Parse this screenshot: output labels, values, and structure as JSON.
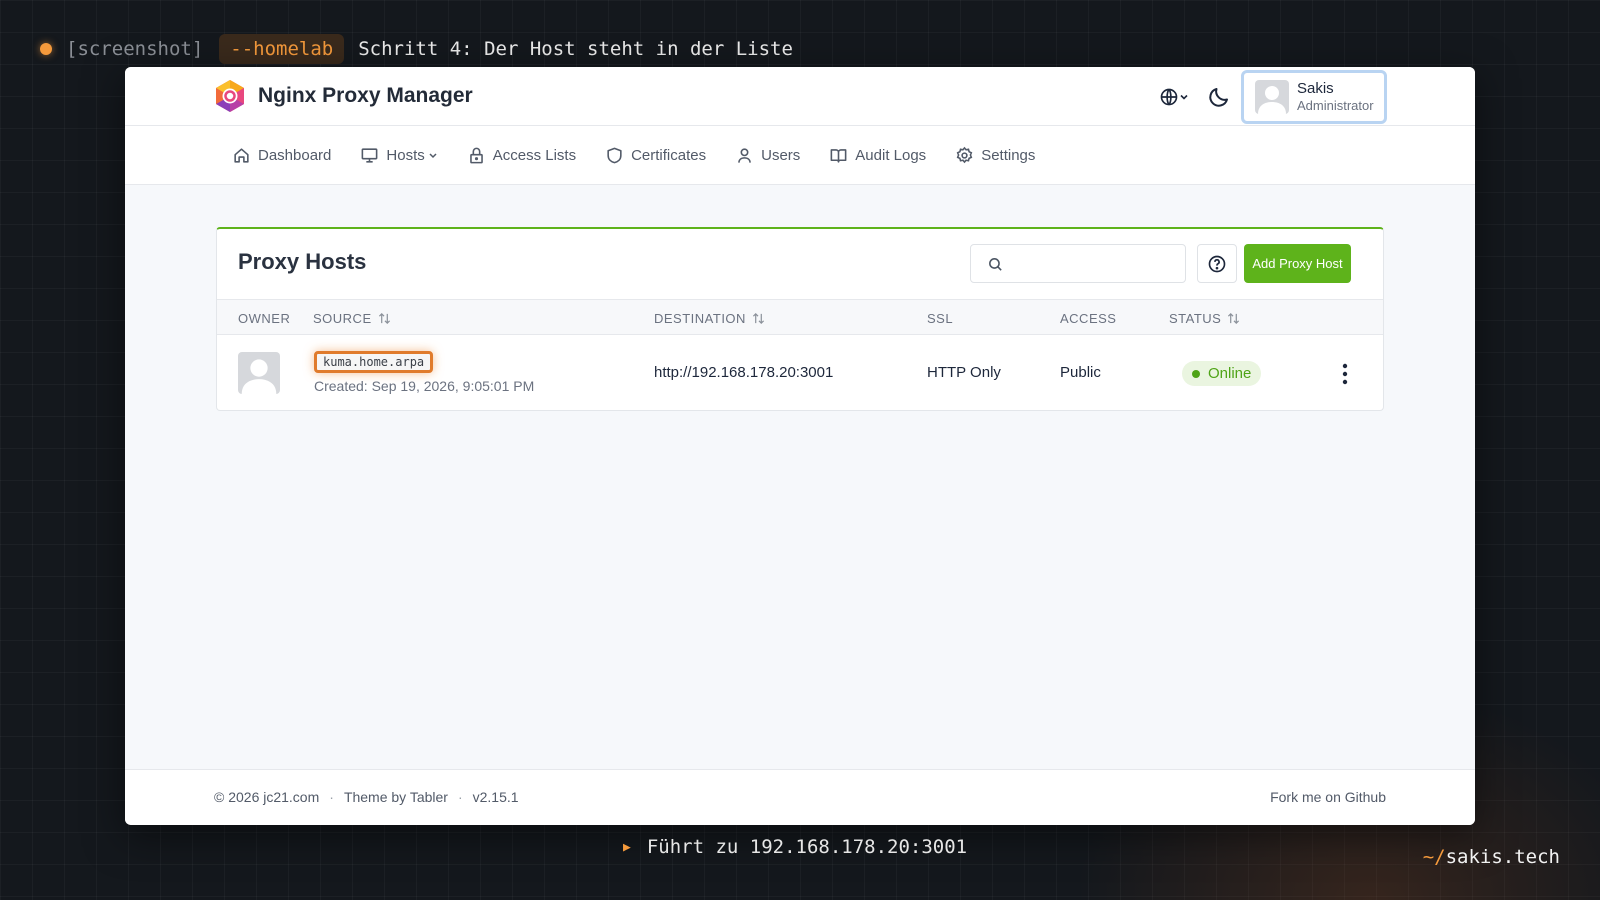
{
  "caption": {
    "tag": "[screenshot]",
    "pill": "--homelab",
    "title": "Schritt 4: Der Host steht in der Liste"
  },
  "app": {
    "name": "Nginx Proxy Manager",
    "user": {
      "name": "Sakis",
      "role": "Administrator"
    }
  },
  "nav": [
    {
      "label": "Dashboard",
      "icon": "home-icon"
    },
    {
      "label": "Hosts",
      "icon": "monitor-icon"
    },
    {
      "label": "Access Lists",
      "icon": "lock-icon"
    },
    {
      "label": "Certificates",
      "icon": "shield-icon"
    },
    {
      "label": "Users",
      "icon": "user-icon"
    },
    {
      "label": "Audit Logs",
      "icon": "book-icon"
    },
    {
      "label": "Settings",
      "icon": "gear-icon"
    }
  ],
  "card": {
    "title": "Proxy Hosts",
    "search_placeholder": "",
    "add_button": "Add Proxy Host",
    "columns": [
      "OWNER",
      "SOURCE",
      "DESTINATION",
      "SSL",
      "ACCESS",
      "STATUS"
    ],
    "rows": [
      {
        "source": "kuma.home.arpa",
        "created": "Created: Sep 19, 2026, 9:05:01 PM",
        "destination": "http://192.168.178.20:3001",
        "ssl": "HTTP Only",
        "access": "Public",
        "status": "Online"
      }
    ]
  },
  "footer": {
    "copyright": "© 2026 jc21.com",
    "theme": "Theme by Tabler",
    "version": "v2.15.1",
    "fork": "Fork me on Github"
  },
  "subcaption": "Führt zu 192.168.178.20:3001",
  "brandmark": {
    "prefix": "~/",
    "site": "sakis.tech"
  },
  "colors": {
    "accent": "#5eb31b",
    "highlight": "#e07b2c",
    "caption_accent": "#f59a3c"
  }
}
